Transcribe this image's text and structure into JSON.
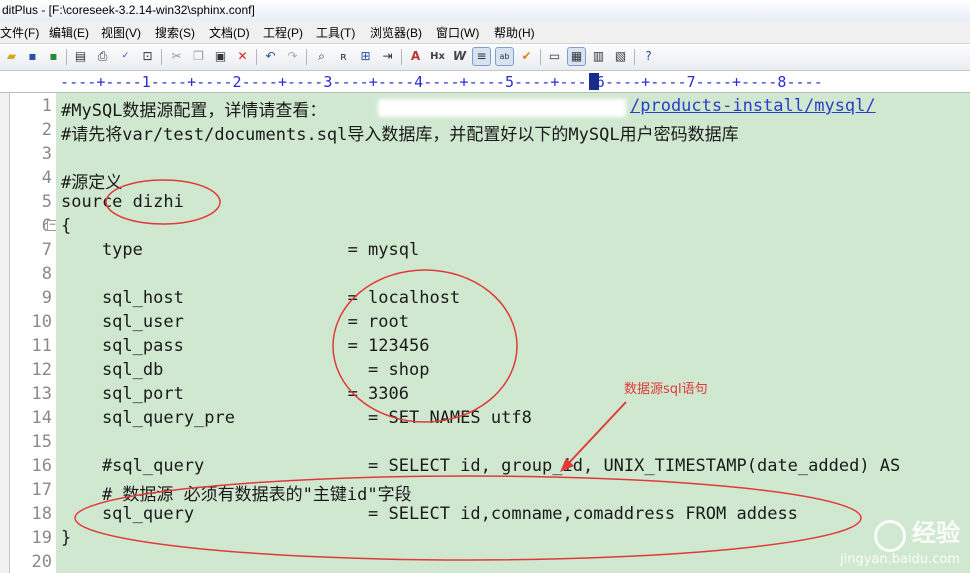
{
  "window": {
    "title": "ditPlus - [F:\\coreseek-3.2.14-win32\\sphinx.conf]"
  },
  "menu": [
    "文件(F)",
    "编辑(E)",
    "视图(V)",
    "搜索(S)",
    "文档(D)",
    "工程(P)",
    "工具(T)",
    "浏览器(B)",
    "窗口(W)",
    "帮助(H)"
  ],
  "toolbar": {
    "open": "open-icon",
    "save": "save-icon",
    "save_all": "save-all-icon",
    "print_preview": "print-preview-icon",
    "print": "print-icon",
    "spell": "spellcheck-icon",
    "cut": "cut-icon",
    "copy": "copy-icon",
    "paste": "paste-icon",
    "delete": "delete-icon",
    "undo": "undo-icon",
    "redo": "redo-icon",
    "find": "find-icon",
    "replace": "replace-icon",
    "font": "font-icon",
    "hex": "Hx",
    "word": "W"
  },
  "ruler": {
    "text": "----+----1----+----2----+----3----+----4----+----5----+----6----+----7----+----8----"
  },
  "code_lines": [
    {
      "n": "1",
      "text": "#MySQL数据源配置，详情请查看：",
      "link": "/products-install/mysql/"
    },
    {
      "n": "2",
      "text": "#请先将var/test/documents.sql导入数据库，并配置好以下的MySQL用户密码数据库"
    },
    {
      "n": "3",
      "text": ""
    },
    {
      "n": "4",
      "text": "#源定义"
    },
    {
      "n": "5",
      "text": "source dizhi"
    },
    {
      "n": "6",
      "text": "{"
    },
    {
      "n": "7",
      "text": "    type                    = mysql"
    },
    {
      "n": "8",
      "text": ""
    },
    {
      "n": "9",
      "text": "    sql_host                = localhost"
    },
    {
      "n": "10",
      "text": "    sql_user                = root"
    },
    {
      "n": "11",
      "text": "    sql_pass                = 123456"
    },
    {
      "n": "12",
      "text": "    sql_db                    = shop"
    },
    {
      "n": "13",
      "text": "    sql_port                = 3306"
    },
    {
      "n": "14",
      "text": "    sql_query_pre             = SET NAMES utf8"
    },
    {
      "n": "15",
      "text": ""
    },
    {
      "n": "16",
      "text": "    #sql_query                = SELECT id, group_id, UNIX_TIMESTAMP(date_added) AS"
    },
    {
      "n": "17",
      "text": "    # 数据源 必须有数据表的\"主键id\"字段"
    },
    {
      "n": "18",
      "text": "    sql_query                 = SELECT id,comname,comaddress FROM addess"
    },
    {
      "n": "19",
      "text": "}"
    },
    {
      "n": "20",
      "text": ""
    }
  ],
  "annotation": {
    "label": "数据源sql语句",
    "color": "#e03a3a"
  },
  "watermark": {
    "brand": "经验",
    "url": "jingyan.baidu.com"
  },
  "colors": {
    "editor_bg": "#d0e8d0",
    "ruler_text": "#2b2bd6",
    "link": "#2a3fc7"
  }
}
